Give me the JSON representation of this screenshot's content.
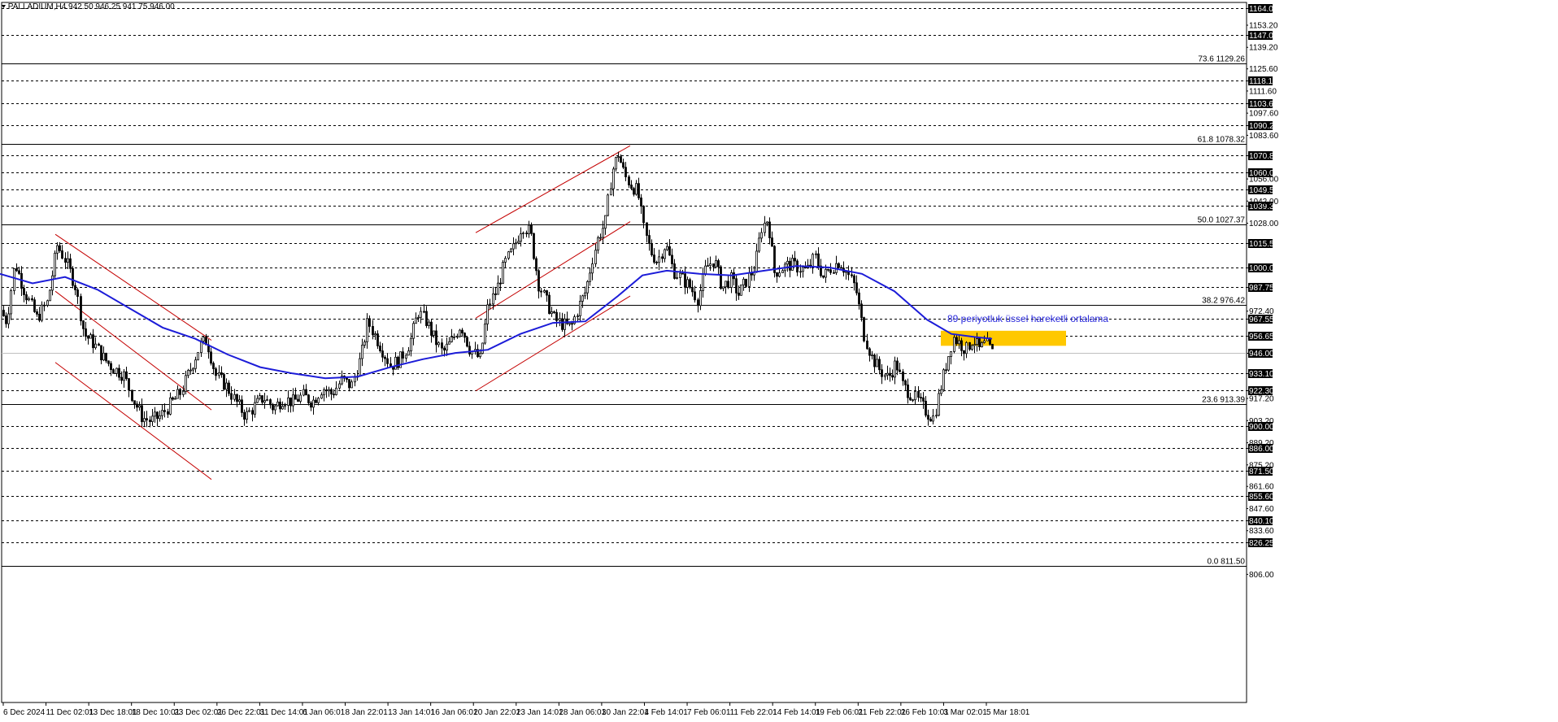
{
  "header": {
    "symbol_line": ".PALLADIUM,H4  942.50 946.25 941.75 946.00"
  },
  "colors": {
    "candle": "#000000",
    "ema": "#1c1cd8",
    "channel": "#c40000",
    "highlight": "#ffc800",
    "grid": "#000000",
    "price_box": "#000000"
  },
  "chart_data": {
    "type": "candlestick",
    "symbol": "PALLADIUM",
    "timeframe": "H4",
    "last_ohlc": {
      "open": 942.5,
      "high": 946.25,
      "low": 941.75,
      "close": 946.0
    },
    "ylim": [
      806.0,
      1167.0
    ],
    "x_labels": [
      "6 Dec 2024",
      "11 Dec 02:01",
      "13 Dec 18:01",
      "18 Dec 10:01",
      "23 Dec 02:01",
      "26 Dec 22:01",
      "31 Dec 14:01",
      "6 Jan 06:01",
      "8 Jan 22:01",
      "13 Jan 14:01",
      "16 Jan 06:01",
      "20 Jan 22:01",
      "23 Jan 14:01",
      "28 Jan 06:01",
      "30 Jan 22:01",
      "4 Feb 14:01",
      "7 Feb 06:01",
      "11 Feb 22:01",
      "14 Feb 14:01",
      "19 Feb 06:01",
      "21 Feb 22:01",
      "26 Feb 10:01",
      "3 Mar 02:01",
      "5 Mar 18:01"
    ],
    "y_ticks_plain": [
      "1153.20",
      "1139.20",
      "1125.60",
      "1111.60",
      "1097.60",
      "1083.60",
      "1056.00",
      "1042.00",
      "1028.00",
      "972.40",
      "917.20",
      "903.20",
      "889.20",
      "875.20",
      "861.60",
      "847.60",
      "833.60",
      "806.00"
    ],
    "price_levels": [
      "1164.00",
      "1147.00",
      "1118.10",
      "1103.60",
      "1090.20",
      "1070.85",
      "1060.00",
      "1049.50",
      "1039.30",
      "1015.55",
      "1000.00",
      "987.75",
      "967.55",
      "956.65",
      "946.00",
      "933.10",
      "922.30",
      "900.00",
      "886.00",
      "871.50",
      "855.60",
      "840.10",
      "826.25"
    ],
    "fib_levels": [
      {
        "label": "73.6 1129.26",
        "price": 1129.26
      },
      {
        "label": "61.8 1078.32",
        "price": 1078.32
      },
      {
        "label": "50.0 1027.37",
        "price": 1027.37
      },
      {
        "label": "38.2 976.42",
        "price": 976.42
      },
      {
        "label": "23.6 913.39",
        "price": 913.39
      },
      {
        "label": "0.0 811.50",
        "price": 811.5
      }
    ],
    "current_price": 946.0,
    "ema_annotation": "89 periyotluk üssel hareketli ortalama",
    "close_path": [
      [
        0,
        973
      ],
      [
        8,
        966
      ],
      [
        18,
        1003
      ],
      [
        30,
        985
      ],
      [
        45,
        968
      ],
      [
        58,
        978
      ],
      [
        70,
        1014
      ],
      [
        80,
        1005
      ],
      [
        92,
        989
      ],
      [
        103,
        958
      ],
      [
        115,
        952
      ],
      [
        128,
        942
      ],
      [
        140,
        936
      ],
      [
        152,
        932
      ],
      [
        165,
        915
      ],
      [
        175,
        905
      ],
      [
        185,
        903
      ],
      [
        197,
        906
      ],
      [
        210,
        914
      ],
      [
        222,
        921
      ],
      [
        234,
        936
      ],
      [
        246,
        951
      ],
      [
        254,
        954
      ],
      [
        265,
        932
      ],
      [
        278,
        925
      ],
      [
        290,
        915
      ],
      [
        302,
        906
      ],
      [
        312,
        912
      ],
      [
        324,
        918
      ],
      [
        336,
        911
      ],
      [
        348,
        917
      ],
      [
        360,
        915
      ],
      [
        372,
        919
      ],
      [
        384,
        915
      ],
      [
        396,
        924
      ],
      [
        408,
        920
      ],
      [
        420,
        929
      ],
      [
        432,
        925
      ],
      [
        444,
        944
      ],
      [
        452,
        966
      ],
      [
        460,
        958
      ],
      [
        470,
        948
      ],
      [
        480,
        938
      ],
      [
        492,
        942
      ],
      [
        504,
        953
      ],
      [
        514,
        972
      ],
      [
        524,
        966
      ],
      [
        534,
        955
      ],
      [
        544,
        946
      ],
      [
        556,
        954
      ],
      [
        566,
        964
      ],
      [
        578,
        948
      ],
      [
        590,
        942
      ],
      [
        600,
        976
      ],
      [
        610,
        985
      ],
      [
        620,
        1002
      ],
      [
        632,
        1013
      ],
      [
        642,
        1027
      ],
      [
        652,
        1022
      ],
      [
        662,
        990
      ],
      [
        672,
        978
      ],
      [
        682,
        967
      ],
      [
        692,
        964
      ],
      [
        702,
        962
      ],
      [
        712,
        976
      ],
      [
        720,
        985
      ],
      [
        728,
        1005
      ],
      [
        736,
        1020
      ],
      [
        744,
        1028
      ],
      [
        752,
        1060
      ],
      [
        760,
        1072
      ],
      [
        768,
        1058
      ],
      [
        776,
        1052
      ],
      [
        784,
        1048
      ],
      [
        792,
        1023
      ],
      [
        800,
        1010
      ],
      [
        808,
        1004
      ],
      [
        818,
        1015
      ],
      [
        828,
        998
      ],
      [
        838,
        993
      ],
      [
        848,
        988
      ],
      [
        858,
        980
      ],
      [
        868,
        1000
      ],
      [
        878,
        1005
      ],
      [
        888,
        987
      ],
      [
        898,
        993
      ],
      [
        908,
        983
      ],
      [
        918,
        992
      ],
      [
        928,
        1000
      ],
      [
        936,
        1025
      ],
      [
        944,
        1031
      ],
      [
        952,
        997
      ],
      [
        962,
        1000
      ],
      [
        972,
        1002
      ],
      [
        982,
        1000
      ],
      [
        992,
        998
      ],
      [
        1002,
        1007
      ],
      [
        1012,
        994
      ],
      [
        1022,
        1000
      ],
      [
        1032,
        1004
      ],
      [
        1042,
        996
      ],
      [
        1052,
        987
      ],
      [
        1062,
        958
      ],
      [
        1072,
        943
      ],
      [
        1082,
        935
      ],
      [
        1092,
        930
      ],
      [
        1102,
        940
      ],
      [
        1110,
        925
      ],
      [
        1120,
        920
      ],
      [
        1130,
        915
      ],
      [
        1140,
        908
      ],
      [
        1148,
        905
      ],
      [
        1156,
        923
      ],
      [
        1164,
        940
      ],
      [
        1172,
        956
      ],
      [
        1180,
        952
      ],
      [
        1188,
        948
      ],
      [
        1196,
        955
      ],
      [
        1204,
        948
      ],
      [
        1212,
        952
      ],
      [
        1220,
        946
      ]
    ],
    "ema_path": [
      [
        0,
        996
      ],
      [
        40,
        990
      ],
      [
        80,
        994
      ],
      [
        120,
        986
      ],
      [
        160,
        974
      ],
      [
        200,
        962
      ],
      [
        240,
        955
      ],
      [
        280,
        945
      ],
      [
        320,
        937
      ],
      [
        360,
        933
      ],
      [
        400,
        930
      ],
      [
        440,
        931
      ],
      [
        480,
        937
      ],
      [
        520,
        942
      ],
      [
        560,
        946
      ],
      [
        600,
        948
      ],
      [
        640,
        958
      ],
      [
        680,
        965
      ],
      [
        720,
        966
      ],
      [
        760,
        982
      ],
      [
        790,
        995
      ],
      [
        820,
        998
      ],
      [
        860,
        996
      ],
      [
        900,
        995
      ],
      [
        940,
        998
      ],
      [
        980,
        1001
      ],
      [
        1020,
        1000
      ],
      [
        1060,
        996
      ],
      [
        1100,
        985
      ],
      [
        1140,
        967
      ],
      [
        1170,
        958
      ],
      [
        1200,
        956
      ],
      [
        1220,
        955
      ]
    ],
    "channels": [
      {
        "from": [
          68,
          1021
        ],
        "to": [
          260,
          954
        ]
      },
      {
        "from": [
          68,
          985
        ],
        "to": [
          260,
          910
        ]
      },
      {
        "from": [
          68,
          940
        ],
        "to": [
          260,
          866
        ]
      },
      {
        "from": [
          585,
          1022
        ],
        "to": [
          775,
          1077
        ]
      },
      {
        "from": [
          585,
          968
        ],
        "to": [
          775,
          1029
        ]
      },
      {
        "from": [
          585,
          922
        ],
        "to": [
          775,
          982
        ]
      }
    ],
    "highlight_zone": {
      "from_x": 1157,
      "to_x": 1311,
      "top": 960.0,
      "bottom": 950.5
    },
    "grid": "dashed horizontal",
    "axis": "right"
  }
}
